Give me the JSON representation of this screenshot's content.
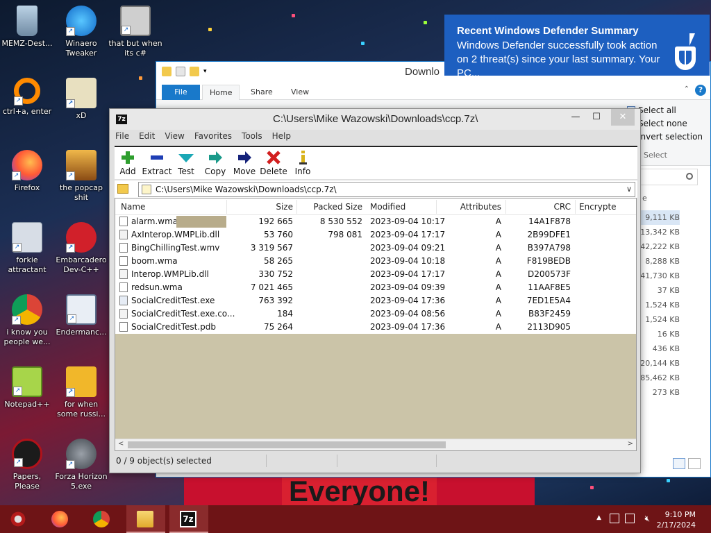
{
  "desktop": {
    "icons": [
      {
        "label": "MEMZ-Dest...",
        "icon": "recycle-bin-icon"
      },
      {
        "label": "Winaero Tweaker",
        "icon": "winaero-icon"
      },
      {
        "label": "that but when its c#",
        "icon": "stacked-windows-icon"
      },
      {
        "label": "ctrl+a, enter",
        "icon": "orange-ring-icon"
      },
      {
        "label": "xD",
        "icon": "hxd-icon"
      },
      {
        "label": "Firefox",
        "icon": "firefox-icon"
      },
      {
        "label": "the popcap shit",
        "icon": "popcap-icon"
      },
      {
        "label": "forkie attractant",
        "icon": "gear-shortcut-icon"
      },
      {
        "label": "Embarcadero Dev-C++",
        "icon": "devcpp-icon"
      },
      {
        "label": "i know you people we...",
        "icon": "chrome-icon"
      },
      {
        "label": "Endermanc...",
        "icon": "window-app-icon"
      },
      {
        "label": "Notepad++",
        "icon": "notepadpp-icon"
      },
      {
        "label": "for when some russi...",
        "icon": "de-icon"
      },
      {
        "label": "Papers, Please",
        "icon": "papers-please-icon"
      },
      {
        "label": "Forza Horizon 5.exe",
        "icon": "flash-icon"
      }
    ],
    "wallpaper_text": "Everyone!"
  },
  "explorer": {
    "title": "Downlo",
    "tabs": {
      "file": "File",
      "home": "Home",
      "share": "Share",
      "view": "View"
    },
    "select_items": [
      "Select all",
      "Select none",
      "Invert selection"
    ],
    "select_group": "Select",
    "column_partial": "e",
    "sizes": [
      "9,111 KB",
      "13,342 KB",
      "42,222 KB",
      "8,288 KB",
      "41,730 KB",
      "37 KB",
      "1,524 KB",
      "1,524 KB",
      "16 KB",
      "436 KB",
      "20,144 KB",
      "85,462 KB",
      "273 KB"
    ]
  },
  "sevenzip": {
    "title": "C:\\Users\\Mike Wazowski\\Downloads\\ccp.7z\\",
    "logo": "7z",
    "menu": [
      "File",
      "Edit",
      "View",
      "Favorites",
      "Tools",
      "Help"
    ],
    "toolbar": [
      {
        "label": "Add",
        "icon": "add-plus-icon",
        "color": "#2e9e2e"
      },
      {
        "label": "Extract",
        "icon": "extract-minus-icon",
        "color": "#1f3fb5"
      },
      {
        "label": "Test",
        "icon": "test-check-icon",
        "color": "#1aa7b5"
      },
      {
        "label": "Copy",
        "icon": "copy-arrow-icon",
        "color": "#1a9a8a"
      },
      {
        "label": "Move",
        "icon": "move-arrow-icon",
        "color": "#15227a"
      },
      {
        "label": "Delete",
        "icon": "delete-x-icon",
        "color": "#d21f1f"
      },
      {
        "label": "Info",
        "icon": "info-icon",
        "color": "#d8b21a"
      }
    ],
    "address": "C:\\Users\\Mike Wazowski\\Downloads\\ccp.7z\\",
    "columns": [
      "Name",
      "Size",
      "Packed Size",
      "Modified",
      "Attributes",
      "CRC",
      "Encrypte"
    ],
    "files": [
      {
        "name": "alarm.wma",
        "size": "192 665",
        "packed": "8 530 552",
        "modified": "2023-09-04 10:17",
        "attr": "A",
        "crc": "14A1F878"
      },
      {
        "name": "AxInterop.WMPLib.dll",
        "size": "53 760",
        "packed": "798 081",
        "modified": "2023-09-04 17:17",
        "attr": "A",
        "crc": "2B99DFE1"
      },
      {
        "name": "BingChillingTest.wmv",
        "size": "3 319 567",
        "packed": "",
        "modified": "2023-09-04 09:21",
        "attr": "A",
        "crc": "B397A798"
      },
      {
        "name": "boom.wma",
        "size": "58 265",
        "packed": "",
        "modified": "2023-09-04 10:18",
        "attr": "A",
        "crc": "F819BEDB"
      },
      {
        "name": "Interop.WMPLib.dll",
        "size": "330 752",
        "packed": "",
        "modified": "2023-09-04 17:17",
        "attr": "A",
        "crc": "D200573F"
      },
      {
        "name": "redsun.wma",
        "size": "7 021 465",
        "packed": "",
        "modified": "2023-09-04 09:39",
        "attr": "A",
        "crc": "11AAF8E5"
      },
      {
        "name": "SocialCreditTest.exe",
        "size": "763 392",
        "packed": "",
        "modified": "2023-09-04 17:36",
        "attr": "A",
        "crc": "7ED1E5A4"
      },
      {
        "name": "SocialCreditTest.exe.co...",
        "size": "184",
        "packed": "",
        "modified": "2023-09-04 08:56",
        "attr": "A",
        "crc": "B83F2459"
      },
      {
        "name": "SocialCreditTest.pdb",
        "size": "75 264",
        "packed": "",
        "modified": "2023-09-04 17:36",
        "attr": "A",
        "crc": "2113D905"
      }
    ],
    "status": "0 / 9 object(s) selected"
  },
  "notification": {
    "title": "Recent Windows Defender Summary",
    "body": "Windows Defender successfully took action on 2 threat(s) since your last summary. Your PC..."
  },
  "taskbar": {
    "time": "9:10 PM",
    "date": "2/17/2024",
    "apps": [
      "start-button-icon",
      "firefox-icon",
      "chrome-icon",
      "file-explorer-icon",
      "7zip-icon"
    ]
  },
  "colors": {
    "accent": "#1979ca",
    "taskbar": "#6e1416",
    "toast": "#1d5fc0"
  }
}
